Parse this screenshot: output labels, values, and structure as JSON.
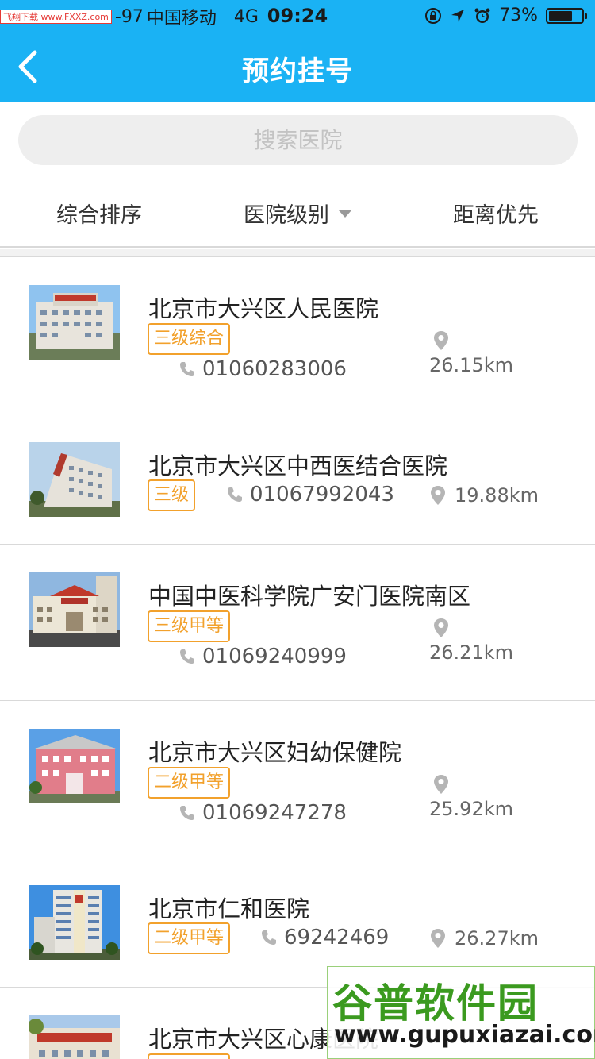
{
  "status_bar": {
    "source_tag": "飞翔下载 www.FXXZ.com",
    "signal": "-97",
    "carrier": "中国移动",
    "network": "4G",
    "time": "09:24",
    "battery_percent": "73%",
    "battery_level": 0.73
  },
  "nav": {
    "title": "预约挂号",
    "back_icon": "chevron-left-icon"
  },
  "search": {
    "placeholder": "搜索医院"
  },
  "filters": [
    {
      "label": "综合排序"
    },
    {
      "label": "医院级别",
      "icon": "caret-down-icon"
    },
    {
      "label": "距离优先"
    }
  ],
  "hospitals": [
    {
      "name": "北京市大兴区人民医院",
      "level": "三级综合",
      "phone": "01060283006",
      "distance": "26.15km"
    },
    {
      "name": "北京市大兴区中西医结合医院",
      "level": "三级",
      "phone": "01067992043",
      "distance": "19.88km"
    },
    {
      "name": "中国中医科学院广安门医院南区",
      "level": "三级甲等",
      "phone": "01069240999",
      "distance": "26.21km"
    },
    {
      "name": "北京市大兴区妇幼保健院",
      "level": "二级甲等",
      "phone": "01069247278",
      "distance": "25.92km"
    },
    {
      "name": "北京市仁和医院",
      "level": "二级甲等",
      "phone": "69242469",
      "distance": "26.27km"
    },
    {
      "name": "北京市大兴区心康医院",
      "level": "",
      "phone": "",
      "distance": ""
    }
  ],
  "watermark": {
    "name": "谷普软件园",
    "url": "www.gupuxiazai.com"
  },
  "colors": {
    "accent": "#1ab2f4",
    "badge": "#f2a12c",
    "divider": "#d9d9d9"
  }
}
